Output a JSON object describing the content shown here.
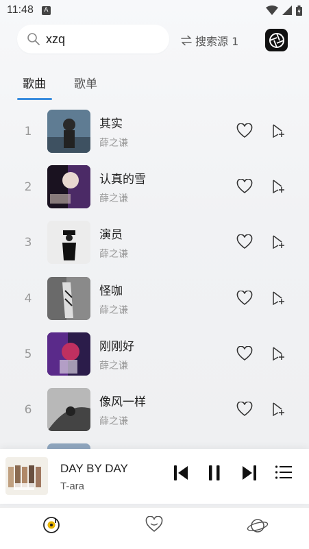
{
  "status_bar": {
    "time": "11:48",
    "notification_icon": "A"
  },
  "search": {
    "value": "xzq",
    "source_label": "搜索源 1"
  },
  "tabs": [
    {
      "label": "歌曲",
      "active": true
    },
    {
      "label": "歌单",
      "active": false
    }
  ],
  "songs": [
    {
      "index": "1",
      "title": "其实",
      "artist": "薛之谦"
    },
    {
      "index": "2",
      "title": "认真的雪",
      "artist": "薛之谦"
    },
    {
      "index": "3",
      "title": "演员",
      "artist": "薛之谦"
    },
    {
      "index": "4",
      "title": "怪咖",
      "artist": "薛之谦"
    },
    {
      "index": "5",
      "title": "刚刚好",
      "artist": "薛之谦"
    },
    {
      "index": "6",
      "title": "像风一样",
      "artist": "薛之谦"
    }
  ],
  "player": {
    "title": "DAY BY DAY",
    "artist": "T-ara"
  },
  "bottom_nav": [
    {
      "icon": "music-disc-icon",
      "active": true
    },
    {
      "icon": "heart-icon",
      "active": false
    },
    {
      "icon": "planet-icon",
      "active": false
    }
  ],
  "colors": {
    "accent": "#3a8dde",
    "active_nav": "#e8b400"
  }
}
